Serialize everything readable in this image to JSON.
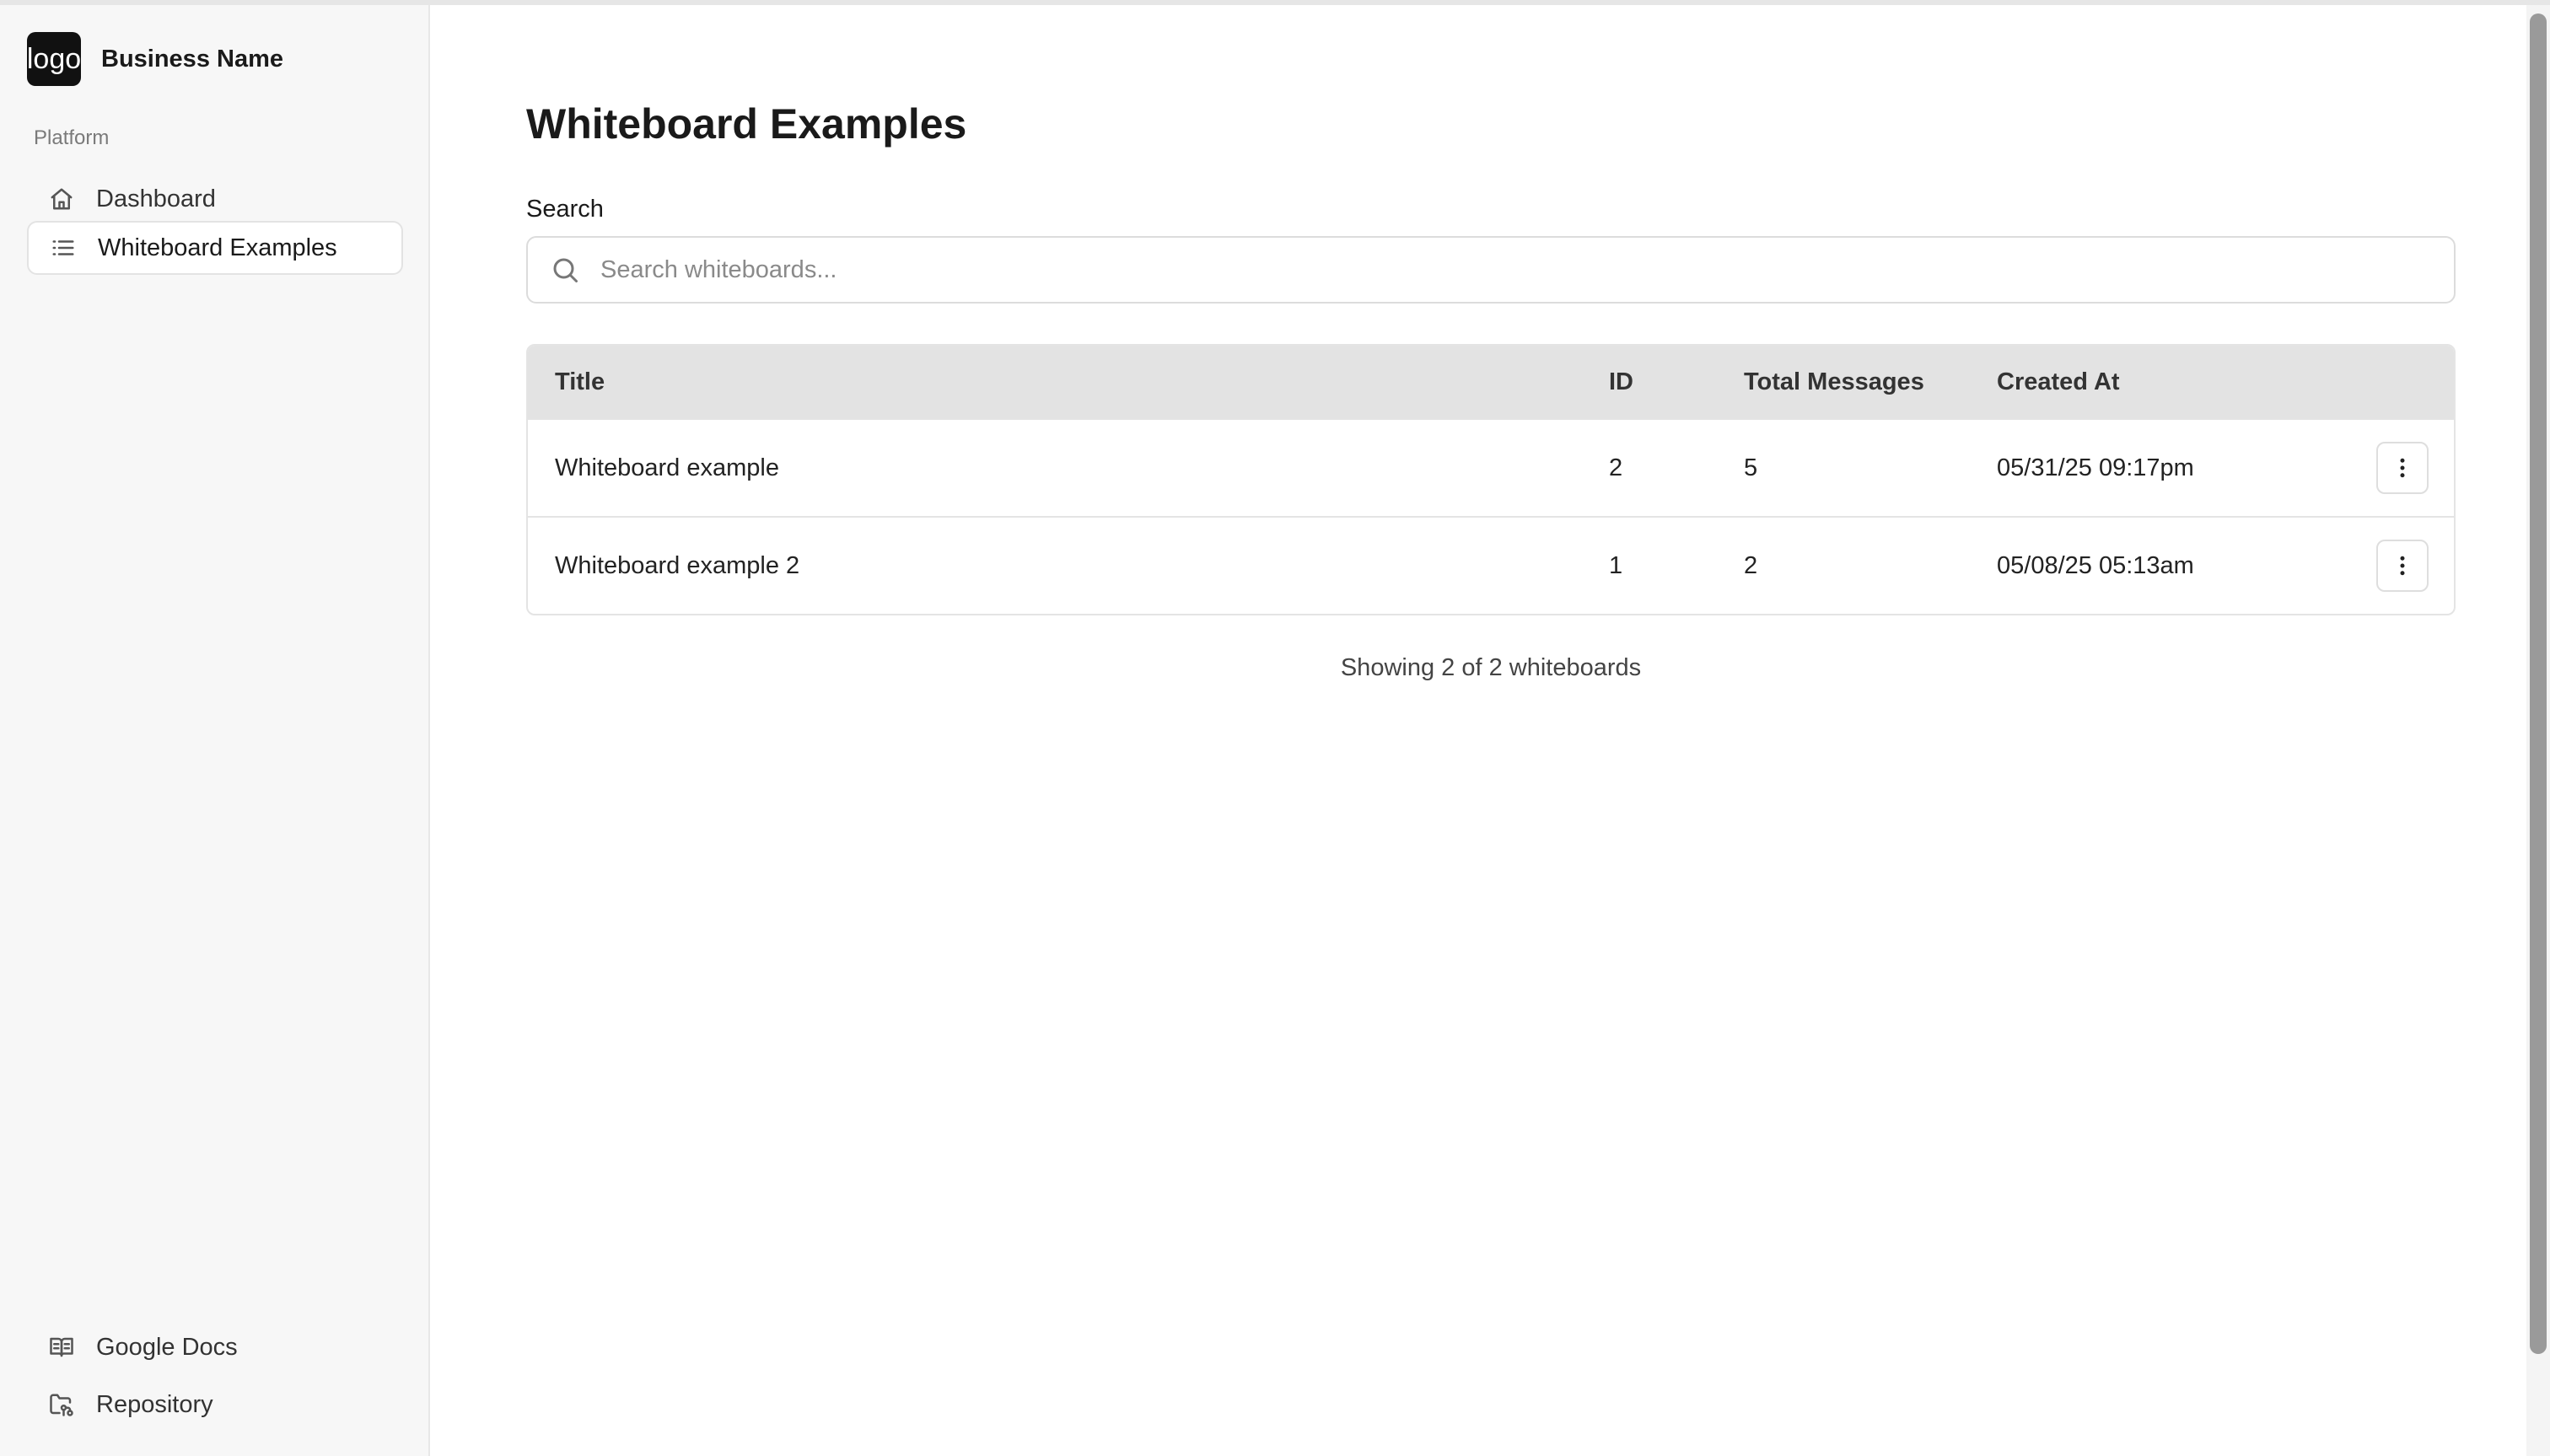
{
  "brand": {
    "logo_text": "logo",
    "name": "Business Name"
  },
  "sidebar": {
    "section_label": "Platform",
    "items": [
      {
        "label": "Dashboard",
        "icon": "home-icon",
        "active": false
      },
      {
        "label": "Whiteboard Examples",
        "icon": "list-icon",
        "active": true
      }
    ],
    "footer_items": [
      {
        "label": "Google Docs",
        "icon": "book-open-icon"
      },
      {
        "label": "Repository",
        "icon": "folder-git-icon"
      }
    ]
  },
  "main": {
    "title": "Whiteboard Examples",
    "search": {
      "label": "Search",
      "placeholder": "Search whiteboards...",
      "value": ""
    },
    "table": {
      "columns": [
        "Title",
        "ID",
        "Total Messages",
        "Created At"
      ],
      "rows": [
        {
          "title": "Whiteboard example",
          "id": "2",
          "total_messages": "5",
          "created_at": "05/31/25 09:17pm"
        },
        {
          "title": "Whiteboard example 2",
          "id": "1",
          "total_messages": "2",
          "created_at": "05/08/25 05:13am"
        }
      ]
    },
    "count_text": "Showing 2 of 2 whiteboards"
  }
}
